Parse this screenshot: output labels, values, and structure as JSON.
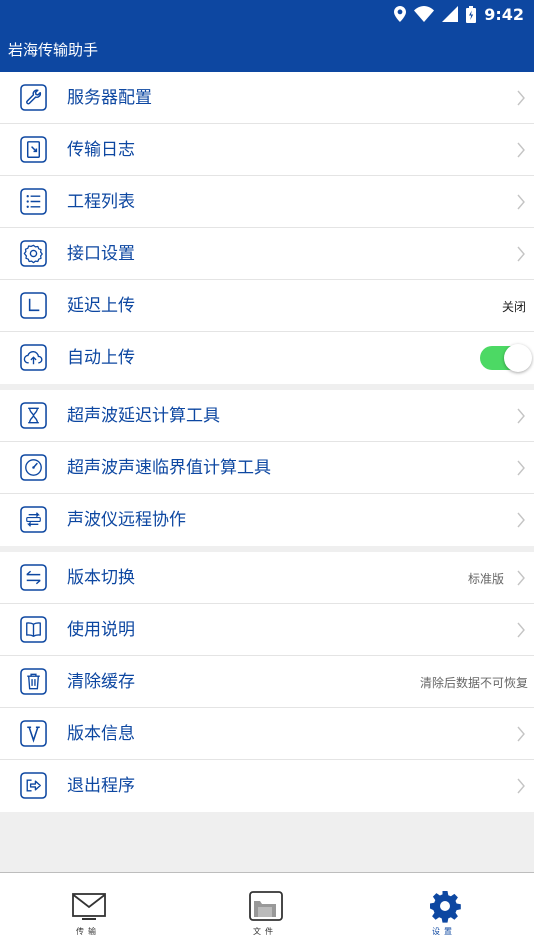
{
  "status_bar": {
    "time": "9:42"
  },
  "app": {
    "title": "岩海传输助手"
  },
  "groups": [
    {
      "items": [
        {
          "label": "服务器配置",
          "icon": "wrench-icon"
        },
        {
          "label": "传输日志",
          "icon": "log-icon"
        },
        {
          "label": "工程列表",
          "icon": "list-icon"
        },
        {
          "label": "接口设置",
          "icon": "gear-icon"
        },
        {
          "label": "延迟上传",
          "icon": "clock-icon",
          "value": "关闭"
        },
        {
          "label": "自动上传",
          "icon": "cloud-upload-icon",
          "toggle_on": true
        }
      ]
    },
    {
      "items": [
        {
          "label": "超声波延迟计算工具",
          "icon": "hourglass-icon"
        },
        {
          "label": "超声波声速临界值计算工具",
          "icon": "gauge-icon"
        },
        {
          "label": "声波仪远程协作",
          "icon": "remote-icon"
        }
      ]
    },
    {
      "items": [
        {
          "label": "版本切换",
          "icon": "switch-icon",
          "value": "标准版"
        },
        {
          "label": "使用说明",
          "icon": "book-icon"
        },
        {
          "label": "清除缓存",
          "icon": "trash-icon",
          "value": "清除后数据不可恢复"
        },
        {
          "label": "版本信息",
          "icon": "version-icon"
        },
        {
          "label": "退出程序",
          "icon": "exit-icon"
        }
      ]
    }
  ],
  "bottom_nav": [
    {
      "label": "传输",
      "icon": "mail-icon",
      "active": false
    },
    {
      "label": "文件",
      "icon": "folder-icon",
      "active": false
    },
    {
      "label": "设置",
      "icon": "gear-icon",
      "active": true
    }
  ],
  "colors": {
    "primary": "#0d47a1",
    "toggle_on": "#4cd964",
    "background": "#efefef"
  }
}
